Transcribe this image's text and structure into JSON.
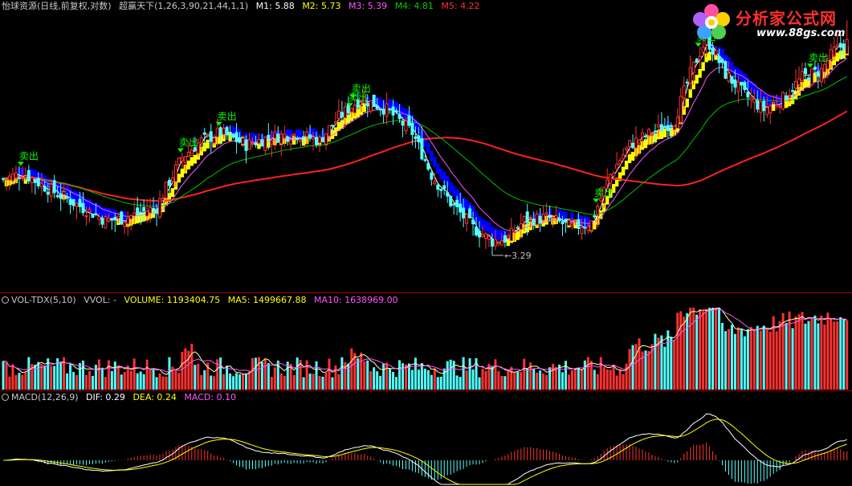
{
  "main_header": {
    "title": "怡球资源(日线,前复权,对数)",
    "indicator": "超赢天下(1,26,3,90,21,44,1,1)",
    "m1_label": "M1: 5.88",
    "m2_label": "M2: 5.73",
    "m3_label": "M3: 5.39",
    "m4_label": "M4: 4.81",
    "m5_label": "M5: 4.22"
  },
  "volume_header": {
    "name": "VOL-TDX(5,10)",
    "vvol": "VVOL: -",
    "volume": "VOLUME: 1193404.75",
    "ma5": "MA5: 1499667.88",
    "ma10": "MA10: 1638969.00"
  },
  "macd_header": {
    "name": "MACD(12,26,9)",
    "dif": "DIF: 0.29",
    "dea": "DEA: 0.24",
    "macd": "MACD: 0.10"
  },
  "logo": {
    "text": "分析家公式网",
    "url": "www.88gs.com"
  },
  "annotations": {
    "low_label": "3.29",
    "sell_label": "卖出"
  },
  "colors": {
    "background": "#000000",
    "up": "#ff3232",
    "down": "#54ffff",
    "m1": "#ffffff",
    "m2": "#ffff00",
    "m3": "#ff55ff",
    "m4": "#00c000",
    "m5": "#ff2020",
    "ribbon_up": "#ffff00",
    "ribbon_down": "#0000ff",
    "sell_signal": "#00ff00",
    "separator": "#a00000"
  },
  "chart_data": {
    "type": "candlestick",
    "sell_signal_bars": [
      6,
      56,
      68,
      109,
      110,
      186,
      218,
      253
    ]
  }
}
